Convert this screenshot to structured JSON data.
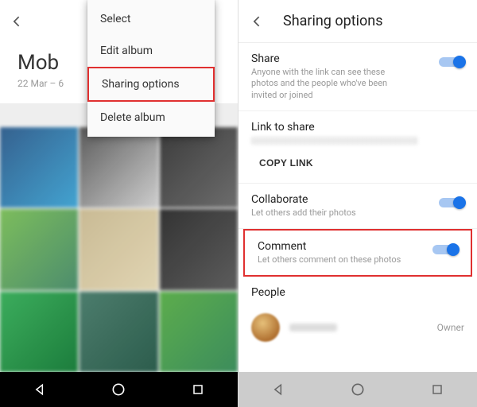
{
  "left": {
    "album_title": "Mob",
    "album_dates": "22 Mar – 6",
    "menu": {
      "select": "Select",
      "edit": "Edit album",
      "sharing": "Sharing options",
      "delete": "Delete album"
    }
  },
  "right": {
    "header_title": "Sharing options",
    "share": {
      "title": "Share",
      "sub": "Anyone with the link can see these photos and the people who've been invited or joined"
    },
    "link": {
      "title": "Link to share",
      "copy_label": "COPY LINK"
    },
    "collab": {
      "title": "Collaborate",
      "sub": "Let others add their photos"
    },
    "comment": {
      "title": "Comment",
      "sub": "Let others comment on these photos"
    },
    "people": {
      "title": "People",
      "role": "Owner"
    }
  }
}
